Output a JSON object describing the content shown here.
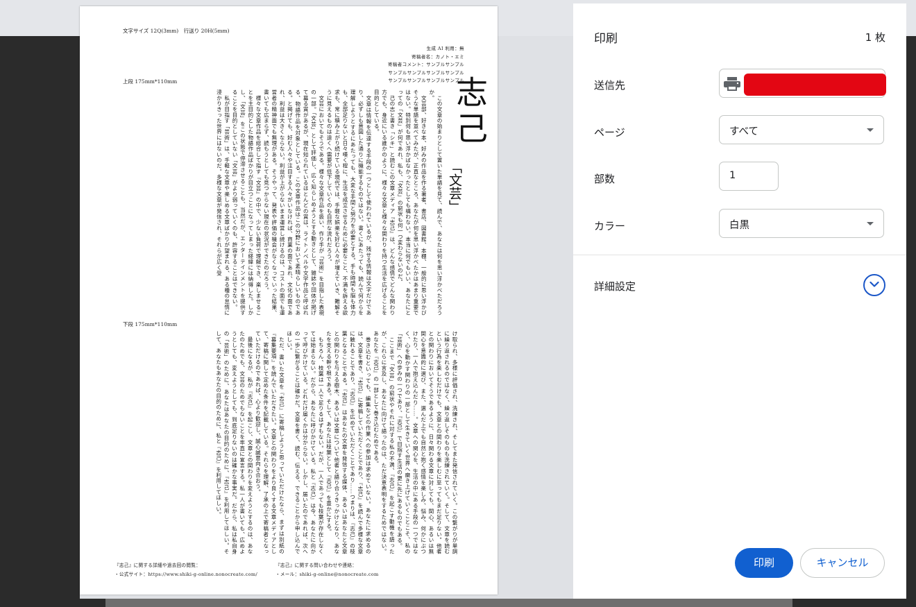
{
  "document": {
    "spec_text": "文字サイズ 12Q(3mm)　行送り 20H(5mm)",
    "upper_label": "上段 175mm*110mm",
    "lower_label": "下段 175mm*110mm",
    "meta_lines": [
      "生成 AI 利用：無",
      "寄稿者名：カノト・エミ",
      "寄稿者コメント：サンプルサンプル",
      "サンプルサンプルサンプルサンプル",
      "サンプルサンプルサンプルサンプル"
    ],
    "title": "志己",
    "subtitle": "「文芸」",
    "upper_body": "　この文章の始まりとして置いた単語を見て、読んで、あなたは何を思い浮かべただろうか。\n　文芸部、好きな本、好みの作品を作る著者、書店、図書館、本棚、一般的に思い浮かびそうな単語を並べてみたが、正直なところ、あなたが何を思い浮かべたかはあまり重要ではない。特別何も思い浮かばなかったとしても構わない。本当に何でもいい、あなたにとっての「文芸」が何であれ、私も、「文芸」の窮状も何一つ変わらないのだ。\n　己の志と書き「シキ」と読むこの文章メディア『志己』は、どんな感情でどんな関わり方でも、身近にいる誰かのように、様々な文章と様々な関わりを持つ生活を広げることを目的としている。\n　文章は情報を伝達する手段の一つとして使われているが、残せる情報は文字だけであり、必ずしも意図した通りに機能するものではない。書くにあたっても、読んで何からを理解しようとするにあたっても、大変な手間と努力を必要とする。手も時間も脳も体力も、全部足りないと日々嘆く程に、生活を成立させるために必要なこと、不満を訴える欲求も、常に積み上がり続けている現代では、手軽な娯楽を好む人々が増えていき、難解そうに見えるものは遠くへ需要が低下していくのも自然な流れだろう。\n　文芸においてもそうである。様々な文章作品を扱い、作り手が「芸術」を目指した表現の一部。「文芸」として評価し、広く知らしめようとする動きとして、雑誌や団体が掲げて募る賞があるが、現在知られているほとんどの賞は、ライトノベルや文学作品と呼ばれる、物語作品を対象としている。この文章作品はこの分野において素晴らしいものである。と掲げても、好む人々や注目する人々がいなければ、商業の面であれ、文化の面であれ、利益は大きくならない。利益が上がらないまま運営し続けるのは、コストの面でも運営者の精神面でも無理がある。そうやって、発表や評価の機会がなくなっていった結果、書いても広まらず、読もうとしても見つからない現在の状況ができたのだろう。\n　様々な文章作品を総合して指す『文芸』の中で、少ない負荷で理解でき、楽しませることを主目的とした物語作品ばかりが目立つことになってしまった経緯には納得した。しかし、「文芸」をこの状態で停滞させることも、当然だが、エンターテインメントを提供することを目的としていない「文芸」がより弱っていくのも、許容することはできない。\n　私が目指す「芸術」は、手軽な文章や楽しめる文章ばかりが望まれる、ある種の怠惰に浸かりきった世界にはないのだ。多様な文章が発信され、それらが広く受",
    "lower_body": "け取られ、多様に評価され、洗練され、そしてまた発信されていく。この繋がりが単調に繰り返されるのではなく、繰り返しそのものも洗練されていく。そして、文章を読むという行為を楽しむだけでも、文章との関わりを楽しむに至ってもまだ足りない。他者との関わりにおいてそうであるように、日々関わる文章に対しても、関心、あるいは無関心を意識的に選び、また、選んだ上でも自然と抱く感情を楽しみ、悩み、何かにぶつけたり、一人で抱え込んだり……。文章への関心を、生活の中にある手段の一つではなく、心を動かす関わりの一部として生きていく世界へ磨き上げていくことこそ、私の「芸術」への歩みの一つであり、『志己』で目指す生活の更に先にあるものでもある。\n　ここまで「文芸」の窮状やそれに対する私の不満、『志己』を起こす動機を語ったが、これらに言及し、あなたに向けて語ったのは、ただ決意表明をするためではない。あなたを『志己』の一部として巻き込むためである。\n　巻き込むといっても、編集などの作業への参加は求めていない。あなたに求めるのは、文章を書き、『志己』に寄稿していただくことであり、『志己』を読んで多様な文章に触れることであり、『志己』を広めていただくことであり……つまりは、『志己』の枝葉となることである。『志己』はあなたの文章を発信する媒体、あるいはあなたと文章との関わりを与える樹木、あるいは文章について他者と語り合うきっかけとなり、あなたを支える幹や根である。そして、あなたは枝葉として『志己』を豊かにする。\n　もちろん、枝葉は一人で足りるはずもない。だが、一人であっても枝葉が存在しなくては始まらない。だから、あなたに呼びかけている。私と『志己』は今、あなたに向かって呼びかけている。どれだけ届くかは分からない。しかし、届いたのであれば、次への一歩に繋がることは確かだ。文章を書く、読む、伝える、できることから申し込んでほしい。\n　ただ、書いた文章を『志己』に寄稿しようと思っていただけたなら、まずは別紙の『募集要項』を読んでいただきたい。文章との関わりをより良くする文章メディアとして、寄稿に関して定めた条件を記載している。それらを理解、了承の上で寄稿者となっていただけるのであれば、心より歓迎し、誠心誠意向き合おう。\n　最後になるが、私が『志己』を起こし、文章との関わりを変えようとするのは、あなたのためでも、文芸のためでもないことを率直に宣言する。私一人が書いても、広めようとしても、変えようとしても、到底足りないのは確かな事実だ。だから、私は私自身の「芸術」のために、あなたはあなたの目的のために、『志己』を利用してほしい。そして、あなたもあなたの目的のために、私と『志己』を利用してほしい。",
    "footer_left": [
      "『志己』に関する詳細や過去回の閲覧：",
      "・公式サイト：https://www.shiki-g-online.nonocreate.com/"
    ],
    "footer_right": [
      "『志己』に関する問い合わせや連絡：",
      "・メール：shiki-g-online@nonocreate.com"
    ]
  },
  "panel": {
    "title": "印刷",
    "sheet_count": "1 枚",
    "destination_label": "送信先",
    "destination_icon": "printer-icon",
    "destination_redacted_color": "#e30613",
    "pages_label": "ページ",
    "pages_value": "すべて",
    "copies_label": "部数",
    "copies_value": "1",
    "color_label": "カラー",
    "color_value": "白黒",
    "advanced_label": "詳細設定",
    "print_button": "印刷",
    "cancel_button": "キャンセル",
    "accent_color": "#1160d0"
  }
}
